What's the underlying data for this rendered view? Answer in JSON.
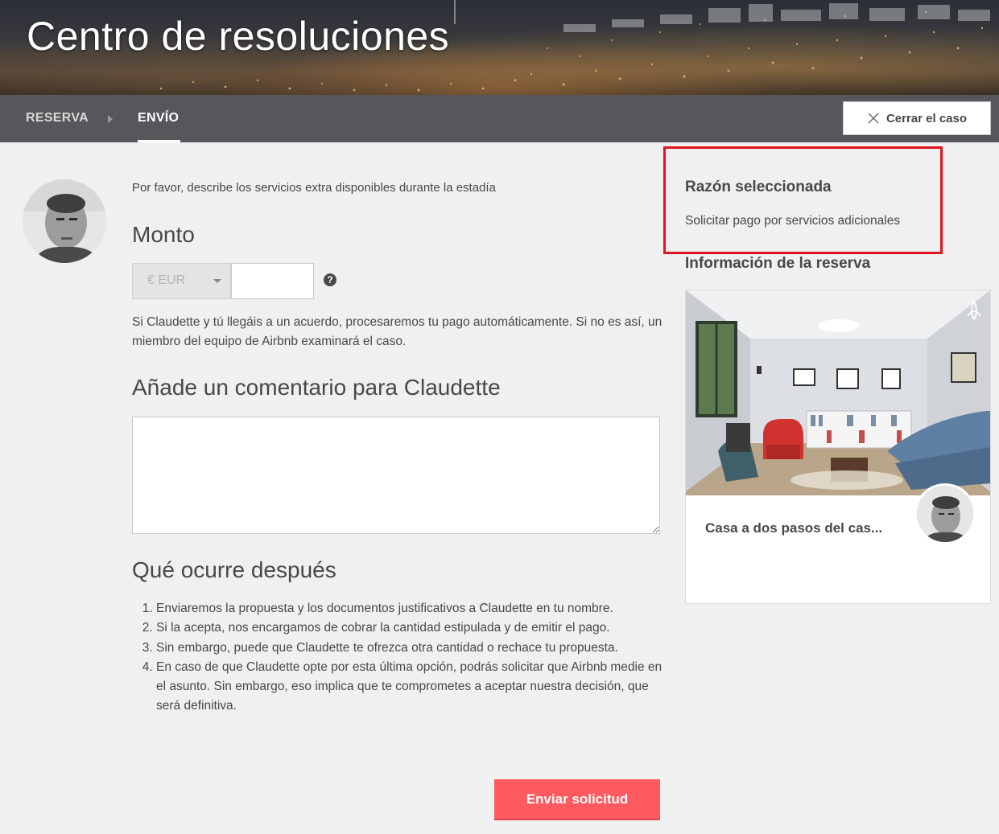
{
  "header": {
    "title": "Centro de resoluciones"
  },
  "nav": {
    "steps": [
      "RESERVA",
      "ENVÍO"
    ],
    "active_step": "ENVÍO",
    "close_label": "Cerrar el caso"
  },
  "form": {
    "intro": "Por favor, describe los servicios extra disponibles durante la estadía",
    "amount_heading": "Monto",
    "currency_selected": "€ EUR",
    "amount_value": "",
    "agreement_text": "Si Claudette y tú llegáis a un acuerdo, procesaremos tu pago automáticamente. Si no es así, un miembro del equipo de Airbnb examinará el caso.",
    "comment_heading": "Añade un comentario para Claudette",
    "comment_value": "",
    "next_heading": "Qué ocurre después",
    "next_steps": [
      "Enviaremos la propuesta y los documentos justificativos a Claudette en tu nombre.",
      "Si la acepta, nos encargamos de cobrar la cantidad estipulada y de emitir el pago.",
      "Sin embargo, puede que Claudette te ofrezca otra cantidad o rechace tu propuesta.",
      "En caso de que Claudette opte por esta última opción, podrás solicitar que Airbnb medie en el asunto. Sin embargo, eso implica que te comprometes a aceptar nuestra decisión, que será definitiva."
    ],
    "submit_label": "Enviar solicitud"
  },
  "sidebar": {
    "reason_title": "Razón seleccionada",
    "reason_text": "Solicitar pago por servicios adicionales",
    "booking_title": "Información de la reserva",
    "listing_name": "Casa a dos pasos del cas..."
  },
  "colors": {
    "accent": "#ff5a5f",
    "highlight_border": "#e0141e",
    "navbar": "#55575a",
    "background": "#f0f0f0"
  },
  "icons": {
    "close": "close-icon",
    "help": "help-icon",
    "dropdown": "chevron-down-icon",
    "step_separator": "chevron-right-icon",
    "brand": "airbnb-logo-icon"
  }
}
